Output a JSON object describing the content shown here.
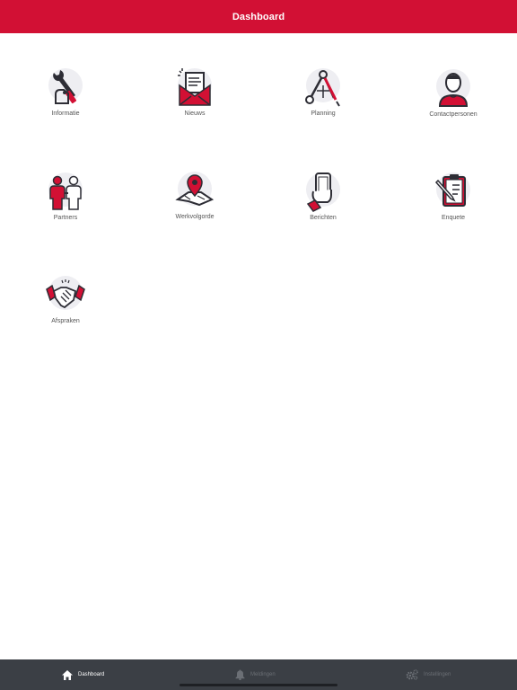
{
  "header": {
    "title": "Dashboard"
  },
  "colors": {
    "brand": "#d21034",
    "icon_dark": "#2d2d35",
    "icon_bg": "#eeeef2",
    "tabbar": "#3b3f45"
  },
  "tiles": [
    {
      "label": "Informatie",
      "icon": "wrench-hand-icon"
    },
    {
      "label": "Nieuws",
      "icon": "news-envelope-icon"
    },
    {
      "label": "Planning",
      "icon": "compass-icon"
    },
    {
      "label": "Contactpersonen",
      "icon": "person-icon"
    },
    {
      "label": "Partners",
      "icon": "partners-icon"
    },
    {
      "label": "Werkvolgorde",
      "icon": "map-pin-icon"
    },
    {
      "label": "Berichten",
      "icon": "phone-hand-icon"
    },
    {
      "label": "Enquete",
      "icon": "clipboard-icon"
    },
    {
      "label": "Afspraken",
      "icon": "handshake-icon"
    }
  ],
  "tabbar": {
    "tabs": [
      {
        "label": "Dashboard",
        "icon": "home-icon",
        "active": true
      },
      {
        "label": "Meldingen",
        "icon": "bell-icon",
        "active": false
      },
      {
        "label": "Instellingen",
        "icon": "gears-icon",
        "active": false
      }
    ]
  }
}
